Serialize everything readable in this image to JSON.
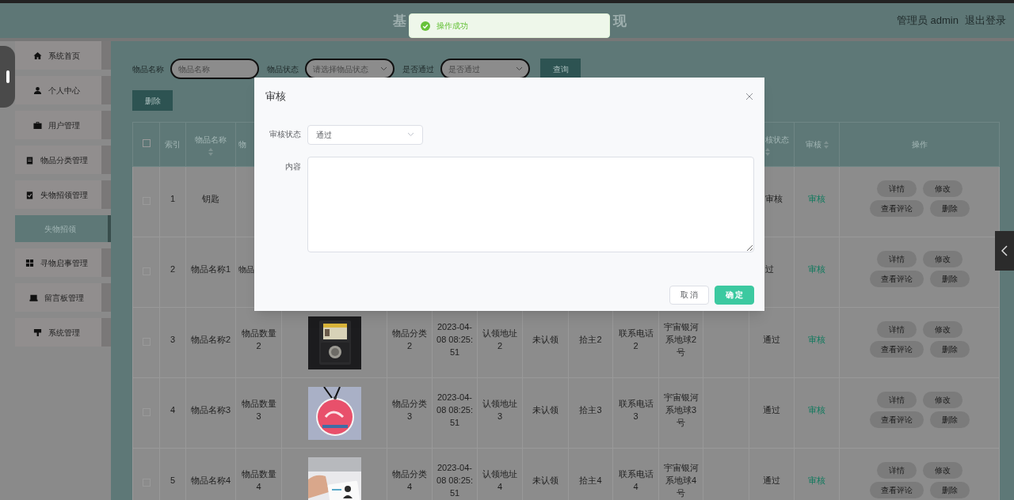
{
  "header": {
    "title_parts": [
      "基",
      "现"
    ],
    "user": "管理员 admin",
    "logout": "退出登录"
  },
  "toast": {
    "kind": "success",
    "message": "操作成功"
  },
  "sidebar": [
    {
      "label": "系统首页",
      "kind": "menu",
      "selected": false
    },
    {
      "label": "个人中心",
      "kind": "menu",
      "selected": false
    },
    {
      "label": "用户管理",
      "kind": "menu",
      "selected": false
    },
    {
      "label": "物品分类管理",
      "kind": "menu",
      "selected": false
    },
    {
      "label": "失物招领管理",
      "kind": "menu",
      "selected": false
    },
    {
      "label": "失物招领",
      "kind": "sub",
      "selected": true
    },
    {
      "label": "寻物启事管理",
      "kind": "menu",
      "selected": false
    },
    {
      "label": "留言板管理",
      "kind": "menu",
      "selected": false
    },
    {
      "label": "系统管理",
      "kind": "menu",
      "selected": false
    }
  ],
  "filters": [
    {
      "label": "物品名称",
      "kind": "input",
      "placeholder": "物品名称"
    },
    {
      "label": "物品状态",
      "kind": "select",
      "placeholder": "请选择物品状态"
    },
    {
      "label": "是否通过",
      "kind": "select",
      "placeholder": "是否通过"
    }
  ],
  "search_button": "查询",
  "delete_button": "删除",
  "table": {
    "select_all": {
      "checked": false
    },
    "columns": [
      {
        "kind": "text",
        "label": "索引",
        "sortable": false
      },
      {
        "kind": "text",
        "label": "物品名称",
        "sortable": true
      },
      {
        "kind": "text",
        "label": "物",
        "sortable": false
      },
      {
        "kind": "covered"
      },
      {
        "kind": "covered"
      },
      {
        "kind": "covered"
      },
      {
        "kind": "covered"
      },
      {
        "kind": "covered"
      },
      {
        "kind": "covered"
      },
      {
        "kind": "covered"
      },
      {
        "kind": "covered"
      },
      {
        "kind": "covered"
      },
      {
        "kind": "text",
        "label": "核状态",
        "sortable": true
      },
      {
        "kind": "text",
        "label": "审核",
        "sortable": true
      },
      {
        "kind": "text",
        "label": "操作",
        "sortable": false
      }
    ],
    "rows": [
      {
        "checked": false,
        "cells": [
          {
            "text": "1"
          },
          {
            "text": "钥匙"
          },
          {
            "kind": "covered"
          },
          {
            "kind": "covered"
          },
          {
            "kind": "covered"
          },
          {
            "kind": "covered"
          },
          {
            "kind": "covered"
          },
          {
            "kind": "covered"
          },
          {
            "kind": "covered"
          },
          {
            "kind": "covered"
          },
          {
            "kind": "covered"
          },
          {
            "kind": "covered"
          },
          {
            "text": "审核"
          },
          {
            "text": "审核",
            "kind": "link"
          }
        ],
        "actions": [
          "详情",
          "修改",
          "查看评论",
          "删除"
        ]
      },
      {
        "checked": false,
        "cells": [
          {
            "text": "2"
          },
          {
            "text": "物品名称1"
          },
          {
            "text": "物品"
          },
          {
            "kind": "covered"
          },
          {
            "kind": "covered"
          },
          {
            "kind": "covered"
          },
          {
            "kind": "covered"
          },
          {
            "kind": "covered"
          },
          {
            "kind": "covered"
          },
          {
            "kind": "covered"
          },
          {
            "kind": "covered"
          },
          {
            "kind": "covered"
          },
          {
            "text": "过"
          },
          {
            "text": "审核",
            "kind": "link"
          }
        ],
        "actions": [
          "详情",
          "修改",
          "查看评论",
          "删除"
        ]
      },
      {
        "checked": false,
        "cells": [
          {
            "text": "3"
          },
          {
            "text": "物品名称2"
          },
          {
            "text": "物品数量2"
          },
          {
            "kind": "picture"
          },
          {
            "text": "物品分类2"
          },
          {
            "text": "2023-04-08 08:25:51"
          },
          {
            "text": "认领地址2"
          },
          {
            "text": "未认领"
          },
          {
            "text": "拾主2"
          },
          {
            "text": "联系电话2"
          },
          {
            "text": "宇宙银河系地球2号"
          },
          {
            "kind": "blank"
          },
          {
            "text": "通过"
          },
          {
            "text": "审核",
            "kind": "link"
          }
        ],
        "actions": [
          "详情",
          "修改",
          "查看评论",
          "删除"
        ]
      },
      {
        "checked": false,
        "cells": [
          {
            "text": "4"
          },
          {
            "text": "物品名称3"
          },
          {
            "text": "物品数量3"
          },
          {
            "kind": "picture"
          },
          {
            "text": "物品分类3"
          },
          {
            "text": "2023-04-08 08:25:51"
          },
          {
            "text": "认领地址3"
          },
          {
            "text": "未认领"
          },
          {
            "text": "拾主3"
          },
          {
            "text": "联系电话3"
          },
          {
            "text": "宇宙银河系地球3号"
          },
          {
            "kind": "blank"
          },
          {
            "text": "通过"
          },
          {
            "text": "审核",
            "kind": "link"
          }
        ],
        "actions": [
          "详情",
          "修改",
          "查看评论",
          "删除"
        ]
      },
      {
        "checked": false,
        "cells": [
          {
            "text": "5"
          },
          {
            "text": "物品名称4"
          },
          {
            "text": "物品数量4"
          },
          {
            "kind": "picture"
          },
          {
            "text": "物品分类4"
          },
          {
            "text": "2023-04-08 08:25:51"
          },
          {
            "text": "认领地址4"
          },
          {
            "text": "未认领"
          },
          {
            "text": "拾主4"
          },
          {
            "text": "联系电话4"
          },
          {
            "text": "宇宙银河系地球4号"
          },
          {
            "kind": "blank"
          },
          {
            "text": "通过"
          },
          {
            "text": "审核",
            "kind": "link"
          }
        ],
        "actions": [
          "详情",
          "修改",
          "查看评论",
          "删除"
        ]
      }
    ]
  },
  "dialog": {
    "title": "审核",
    "fields": [
      {
        "kind": "select",
        "label": "审核状态",
        "value": "通过"
      },
      {
        "kind": "textarea",
        "label": "内容"
      }
    ],
    "buttons": [
      {
        "label": "取 消",
        "kind": "default"
      },
      {
        "label": "确 定",
        "kind": "primary"
      }
    ]
  }
}
